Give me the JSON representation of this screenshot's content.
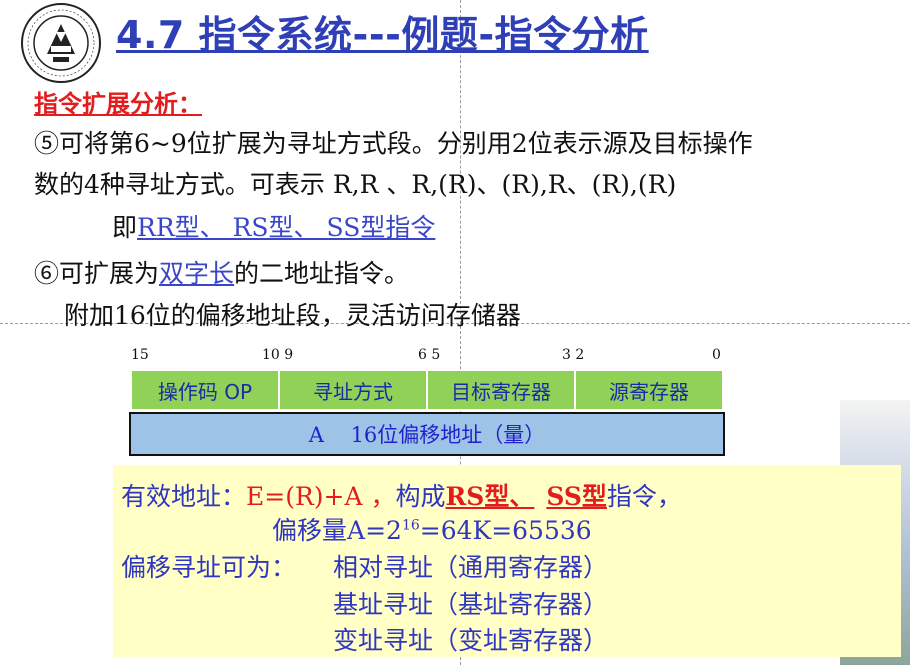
{
  "slide": {
    "title": "4.7 指令系统---例题-指令分析",
    "section_heading": "指令扩展分析：",
    "item5_line1": "⑤可将第6~9位扩展为寻址方式段。分别用2位表示源及目标操作",
    "item5_line2": "数的4种寻址方式。可表示 R,R 、R,(R)、(R),R、(R),(R)",
    "item5_line3_prefix": "即",
    "item5_line3_types": "RR型、 RS型、 SS型指令",
    "item6_prefix": "⑥可扩展为",
    "item6_link": "双字长",
    "item6_suffix": "的二地址指令。",
    "item6_line2": "附加16位的偏移地址段，灵活访问存储器"
  },
  "format": {
    "bit_labels": [
      "15",
      "10 9",
      "6 5",
      "3 2",
      "0"
    ],
    "fields": [
      "操作码 OP",
      "寻址方式",
      "目标寄存器",
      "源寄存器"
    ],
    "offset_field": "A    16位偏移地址（量）"
  },
  "note_box": {
    "ea_label": "有效地址：",
    "ea_formula": "E=(R)+A ，",
    "compose": "构成",
    "rs_type": "RS型、",
    "ss_type": "SS型",
    "instr": "指令，",
    "offset_label": "偏移量",
    "offset_formula_base": "A=2",
    "offset_exp": "16",
    "offset_formula_rest": "=64K=65536",
    "modes_label": "偏移寻址可为：",
    "modes": [
      "相对寻址（通用寄存器）",
      "基址寻址（基址寄存器）",
      "变址寻址（变址寄存器）"
    ]
  },
  "colors": {
    "title": "#2f3fb5",
    "heading": "#e31d1d",
    "field_fill": "#8fd257",
    "offset_fill": "#9dc3e6",
    "note_fill": "#ffffc6"
  }
}
